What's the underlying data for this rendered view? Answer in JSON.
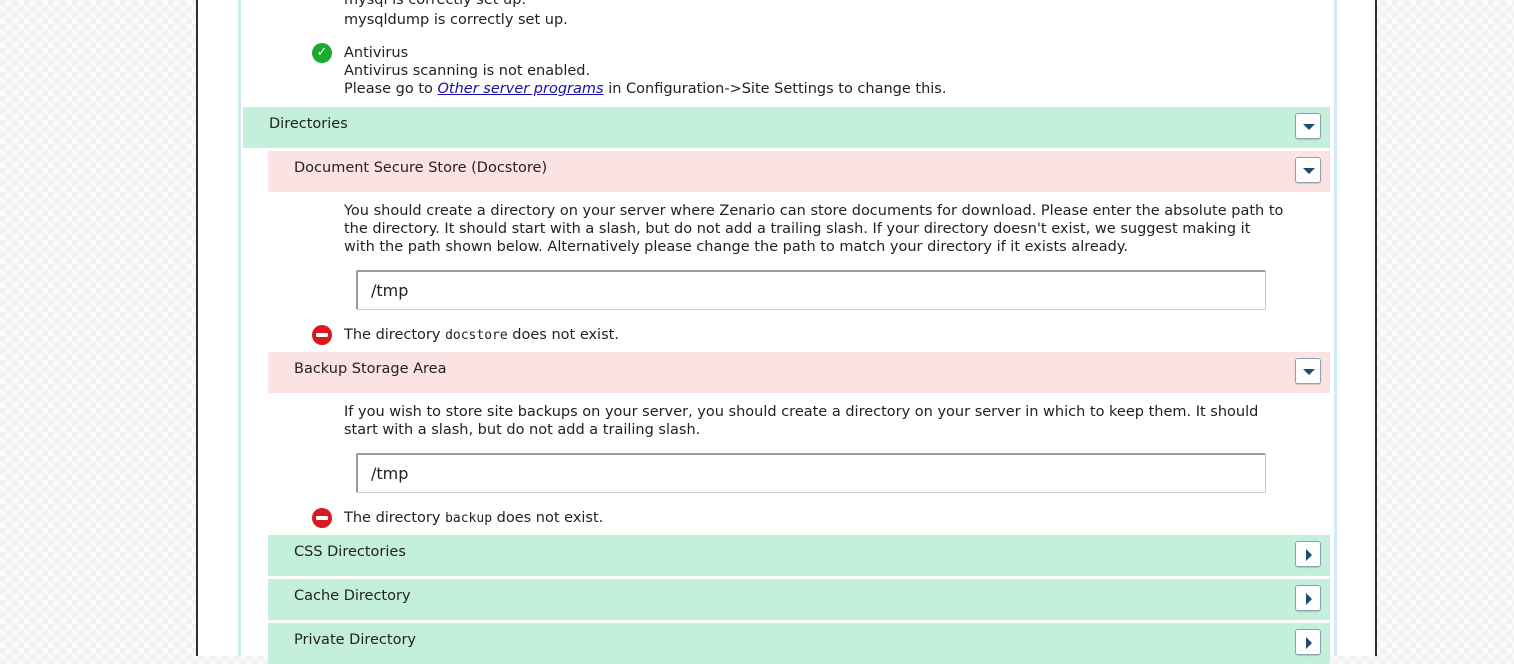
{
  "checks": {
    "mysql_line1": "mysql is correctly set up.",
    "mysql_line2": "mysqldump is correctly set up.",
    "antivirus": {
      "title": "Antivirus",
      "status": "Antivirus scanning is not enabled.",
      "hint_prefix": "Please go to",
      "hint_link": "Other server programs",
      "hint_suffix": "in Configuration->Site Settings to change this."
    }
  },
  "directories": {
    "title": "Directories",
    "docstore": {
      "title": "Document Secure Store (Docstore)",
      "desc_lines": [
        "You should create a directory on your server where Zenario can store documents for download. Please enter the absolute path to",
        "the directory. It should start with a slash, but do not add a trailing slash. If your directory doesn't exist, we suggest making it",
        "with the path shown below. Alternatively please change the path to match your directory if it exists already."
      ],
      "path_value": "/tmp",
      "error_prefix": "The directory",
      "error_dir": "docstore",
      "error_suffix": "does not exist."
    },
    "backup": {
      "title": "Backup Storage Area",
      "desc_lines": [
        "If you wish to store site backups on your server, you should create a directory on your server in which to keep them. It should",
        "start with a slash, but do not add a trailing slash."
      ],
      "path_value": "/tmp",
      "error_prefix": "The directory",
      "error_dir": "backup",
      "error_suffix": "does not exist."
    },
    "css": {
      "title": "CSS Directories"
    },
    "cache": {
      "title": "Cache Directory"
    },
    "private": {
      "title": "Private Directory"
    }
  },
  "colors": {
    "section_green": "#c4efda",
    "section_pink": "#fbe3e3",
    "ok_green": "#1aaa30",
    "error_red": "#d61a1f"
  },
  "icons": {
    "ok": "check-circle-icon",
    "error": "no-entry-icon",
    "collapse": "chevron-down-icon",
    "expand": "chevron-right-icon"
  }
}
